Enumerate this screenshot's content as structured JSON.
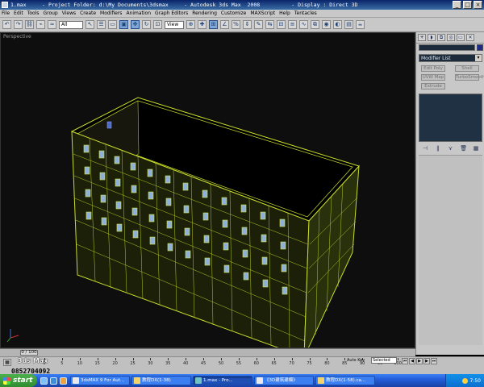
{
  "window": {
    "title": "1.max     - Project Folder: d:\\My Documents\\3dsmax     - Autodesk 3ds Max  2008          - Display : Direct 3D",
    "minimize": "_",
    "maximize": "□",
    "close": "×"
  },
  "menu": [
    "File",
    "Edit",
    "Tools",
    "Group",
    "Views",
    "Create",
    "Modifiers",
    "Animation",
    "Graph Editors",
    "Rendering",
    "Customize",
    "MAXScript",
    "Help",
    "Tentacles"
  ],
  "toolbar": {
    "selection_filter": "All",
    "ref_coord": "View"
  },
  "viewport": {
    "label": "Perspective"
  },
  "command_panel": {
    "modifier_list": "Modifier List",
    "buttons": [
      "Edit Poly",
      "Shell",
      "UVW Map",
      "TurboSmooth",
      "Extrude"
    ]
  },
  "timeline": {
    "frame_indicator": "0 / 100",
    "ticks": [
      "0",
      "5",
      "10",
      "15",
      "20",
      "25",
      "30",
      "35",
      "40",
      "45",
      "50",
      "55",
      "60",
      "65",
      "70",
      "75",
      "80",
      "85",
      "90",
      "95",
      "100"
    ]
  },
  "status": {
    "overlay_text": "3ds Max",
    "number": "0852704092",
    "autokey_label": "Auto Key",
    "autokey_value": "Selected"
  },
  "taskbar": {
    "start_label": "start",
    "tasks": [
      "3dsMAX 9 For Aut...",
      "教程DX(1-38)",
      "1.max - Pro...",
      "《3D建筑建模》",
      "教程DX(1-58).ca..."
    ],
    "clock": "7:50"
  },
  "colors": {
    "wireframe": "#c8dc2a",
    "viewport_bg": "#0e0e0e",
    "window": "#6fb8e8"
  }
}
